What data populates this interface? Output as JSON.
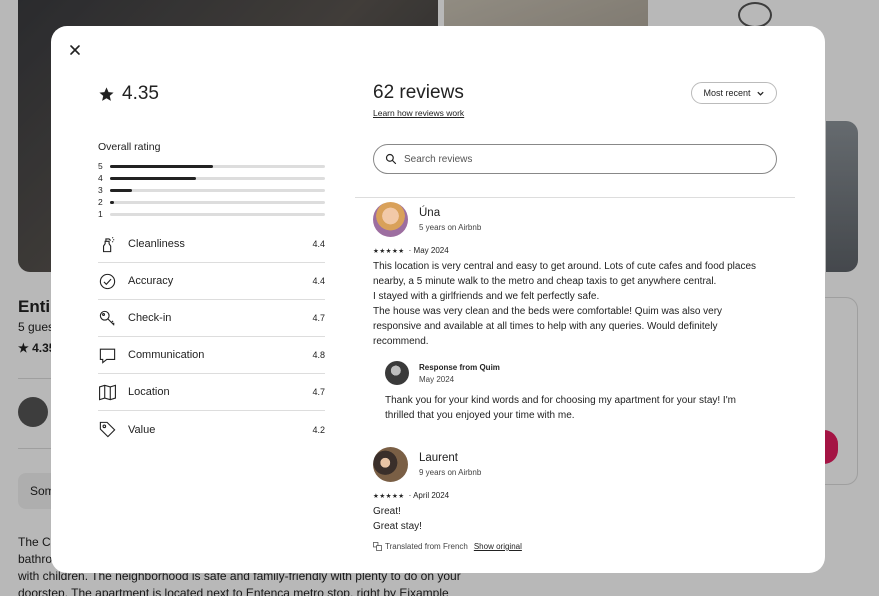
{
  "background": {
    "listing_title": "Entir",
    "listing_sub": "5 gues",
    "listing_rating": "★ 4.35",
    "chip_label": "Som",
    "description": "The C\nbathro\nwith children. The neighborhood is safe and family-friendly with plenty to do on your\ndoorstep. The apartment is located next to Entenca metro stop, right by Eixample"
  },
  "modal": {
    "overall": {
      "score": "4.35",
      "label": "Overall rating"
    },
    "distribution": [
      {
        "stars": "5",
        "fraction": 0.48
      },
      {
        "stars": "4",
        "fraction": 0.4
      },
      {
        "stars": "3",
        "fraction": 0.1
      },
      {
        "stars": "2",
        "fraction": 0.02
      },
      {
        "stars": "1",
        "fraction": 0.0
      }
    ],
    "categories": [
      {
        "label": "Cleanliness",
        "score": "4.4",
        "icon": "spray-bottle-icon"
      },
      {
        "label": "Accuracy",
        "score": "4.4",
        "icon": "check-circle-icon"
      },
      {
        "label": "Check-in",
        "score": "4.7",
        "icon": "key-icon"
      },
      {
        "label": "Communication",
        "score": "4.8",
        "icon": "speech-bubble-icon"
      },
      {
        "label": "Location",
        "score": "4.7",
        "icon": "map-icon"
      },
      {
        "label": "Value",
        "score": "4.2",
        "icon": "tag-icon"
      }
    ],
    "reviews_header": {
      "count_label": "62 reviews",
      "learn_link": "Learn how reviews work",
      "sort_label": "Most recent",
      "search_placeholder": "Search reviews"
    },
    "reviews": [
      {
        "name": "Úna",
        "meta": "5 years on Airbnb",
        "stars": "★★★★★",
        "date": "· May 2024",
        "text": "This location is very central and easy to get around. Lots of cute cafes and food places nearby, a 5 minute walk to the metro and cheap taxis to get anywhere central.\nI stayed with a girlfriends and we felt perfectly safe.\nThe house was very clean and the beds were comfortable! Quim was also very responsive and available at all times to help with any queries. Would definitely recommend.",
        "response": {
          "title": "Response from Quim",
          "date": "May 2024",
          "text": "Thank you for your kind words and for choosing my apartment for your stay! I'm thrilled that you enjoyed your time with me."
        }
      },
      {
        "name": "Laurent",
        "meta": "9 years on Airbnb",
        "stars": "★★★★★",
        "date": "· April 2024",
        "text": "Great!\nGreat stay!",
        "translated_label": "Translated from French",
        "show_original": "Show original"
      }
    ]
  }
}
